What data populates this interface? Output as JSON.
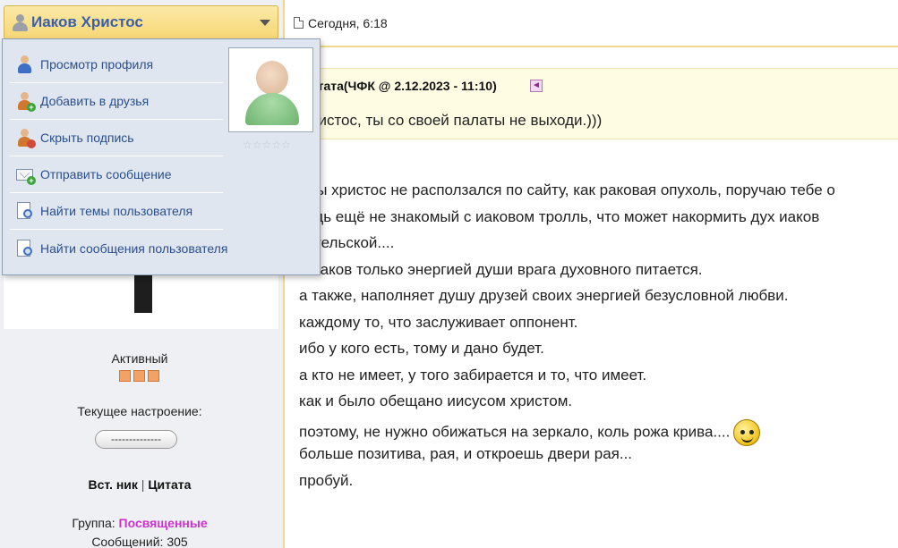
{
  "user": {
    "name": "Иаков Христос",
    "status": "Активный",
    "mood_label": "Текущее настроение:",
    "mood_value": "--------------",
    "insert_nick": "Вст. ник",
    "separator": "|",
    "quote_label": "Цитата",
    "group_label": "Группа:",
    "group_value": "Посвященные",
    "posts_label": "Сообщений:",
    "posts_count": "305",
    "rating_stars": "☆☆☆☆☆",
    "status_color": "#f3a266",
    "group_color": "#cc33cc"
  },
  "menu": {
    "items": [
      {
        "label": "Просмотр профиля",
        "icon": "person-icon"
      },
      {
        "label": "Добавить в друзья",
        "icon": "add-friend-icon"
      },
      {
        "label": "Скрыть подпись",
        "icon": "hide-signature-icon"
      },
      {
        "label": "Отправить сообщение",
        "icon": "send-message-icon"
      },
      {
        "label": "Найти темы пользователя",
        "icon": "search-topics-icon"
      },
      {
        "label": "Найти сообщения пользователя",
        "icon": "search-posts-icon"
      }
    ]
  },
  "post": {
    "date": "Сегодня, 6:18",
    "quote_header": "итата(ЧФК @ 2.12.2023 - 11:10)",
    "quote_jump": "◄",
    "quote_text": "ристос, ты со своей палаты не выходи.)))",
    "lines": [
      "обы христос не расползался по сайту, как раковая опухоль, поручаю тебе о",
      "будь ещё не знакомый с иаковом тролль, что может накормить дух иаков",
      "ангельской....",
      "о иаков только энергией души врага духовного питается.",
      "а также, наполняет душу друзей своих энергией безусловной любви.",
      "каждому то, что заслуживает оппонент.",
      "ибо у кого есть, тому и дано будет.",
      "а кто не имеет, у того забирается и то, что имеет.",
      "как и было обещано иисусом христом.",
      "поэтому, не нужно обижаться на зеркало, коль рожа крива....",
      "больше позитива, рая, и откроешь двери рая...",
      "пробуй."
    ]
  },
  "colors": {
    "header_gold": "#f6d776",
    "link_blue": "#3b5fa8",
    "menu_bg": "#dfe6f0",
    "quote_bg": "#fffce4"
  }
}
